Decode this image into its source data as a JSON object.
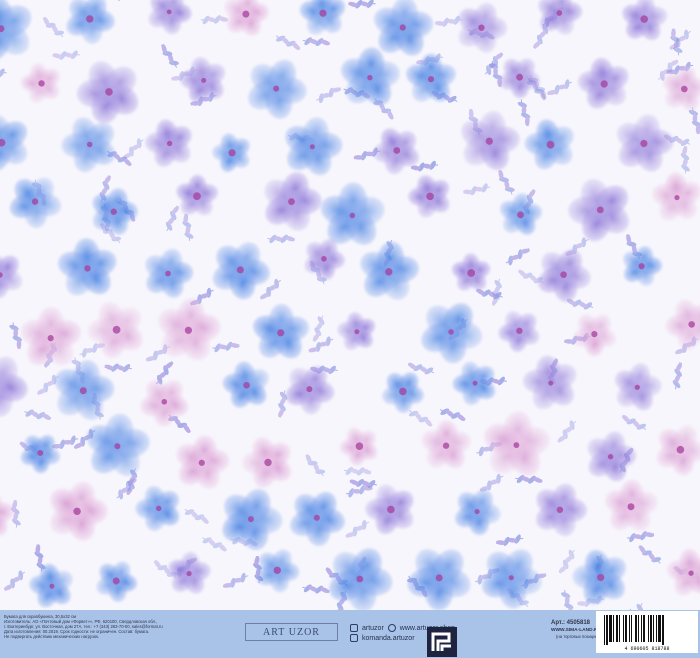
{
  "footer": {
    "info_lines": [
      "Бумага для скрапбукинга, 30,5х32 см",
      "Изготовитель: АО «Почтовый дом «Форвет»», РФ, 620100, Свердловская обл.,",
      "г. Екатеринбург, ул. Восточная, дом 27А, тел.: +7 (343) 263-70-00, sales@format.ru",
      "Дата изготовления: 00.2019. Срок годности: не ограничен. Состав: бумага.",
      "Не подвергать действию механических нагрузок."
    ],
    "brand": "ART UZOR",
    "social": [
      {
        "icon": "instagram-icon",
        "text": "artuzor"
      },
      {
        "icon": "web-icon",
        "text": "www.artuzor.shop"
      },
      {
        "icon": "mail-icon",
        "text": "komanda.artuzor"
      }
    ],
    "article": "Арт.: 4505818",
    "site": "WWW.SIMA-LAND.RU",
    "note": "(на торговых позициях)",
    "barcode_number": "4 690605 818788"
  },
  "colors": {
    "blue": "#5d8ee0",
    "violet": "#8f75d8",
    "pink": "#e1a3d0",
    "footer": "#a9c3e8"
  }
}
